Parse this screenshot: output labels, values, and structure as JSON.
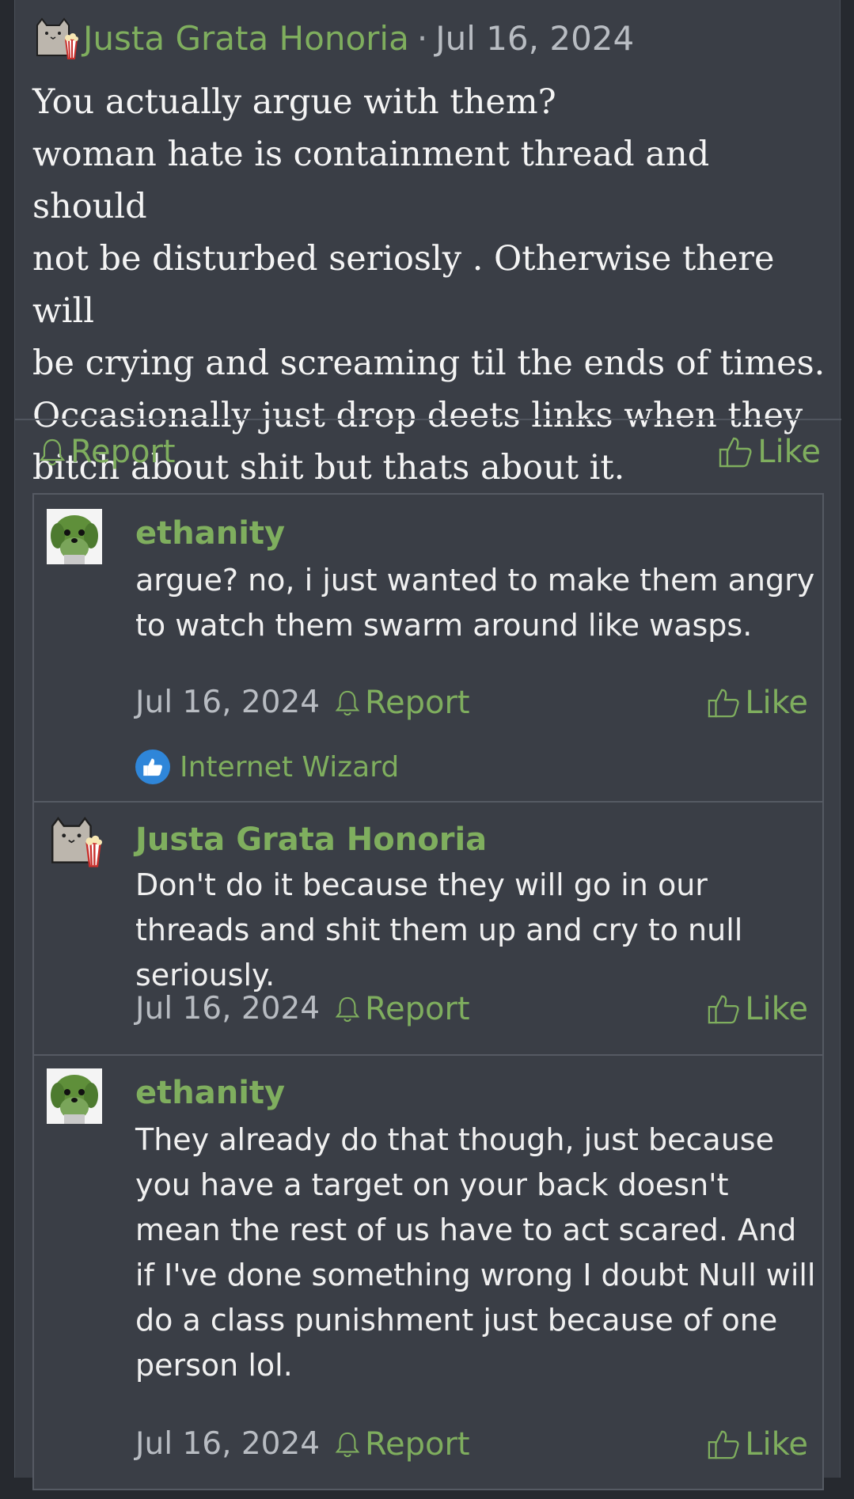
{
  "post": {
    "author": "Justa Grata Honoria",
    "separator": "·",
    "date": "Jul 16, 2024",
    "body": "You actually argue with them?\nwoman hate is containment thread and should\nnot be disturbed seriosly . Otherwise there will\nbe crying and screaming til the ends of times.\nOccasionally just drop deets links when they\nbitch about shit but thats about it.",
    "report_label": "Report",
    "like_label": "Like"
  },
  "replies": [
    {
      "author": "ethanity",
      "text": "argue? no, i just wanted to make them angry to watch them swarm around like wasps.",
      "date": "Jul 16, 2024",
      "report_label": "Report",
      "like_label": "Like",
      "reaction": "Internet Wizard"
    },
    {
      "author": "Justa Grata Honoria",
      "text": "Don't do it because they will go in our threads and shit them up and cry to null seriously.",
      "date": "Jul 16, 2024",
      "report_label": "Report",
      "like_label": "Like"
    },
    {
      "author": "ethanity",
      "text": "They already do that though, just because you have a target on your back doesn't mean the rest of us have to act scared. And if I've done something wrong I doubt Null will do a class punishment just because of one person lol.",
      "date": "Jul 16, 2024",
      "report_label": "Report",
      "like_label": "Like"
    }
  ],
  "icons": {
    "report": "bell-icon",
    "like": "thumbs-up-icon",
    "reaction": "thumbs-up-badge-icon"
  },
  "colors": {
    "accent": "#7fae5e",
    "background": "#3a3e46",
    "page_background": "#26292f"
  }
}
